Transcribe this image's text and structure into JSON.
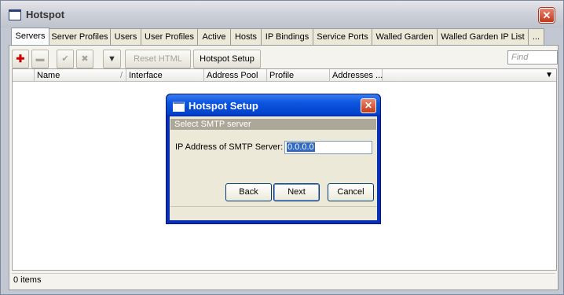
{
  "window": {
    "title": "Hotspot",
    "close_label": "✕"
  },
  "tabs": [
    {
      "label": "Servers"
    },
    {
      "label": "Server Profiles"
    },
    {
      "label": "Users"
    },
    {
      "label": "User Profiles"
    },
    {
      "label": "Active"
    },
    {
      "label": "Hosts"
    },
    {
      "label": "IP Bindings"
    },
    {
      "label": "Service Ports"
    },
    {
      "label": "Walled Garden"
    },
    {
      "label": "Walled Garden IP List"
    },
    {
      "label": "..."
    }
  ],
  "toolbar": {
    "add_glyph": "✚",
    "remove_glyph": "▬",
    "enable_glyph": "✔",
    "disable_glyph": "✖",
    "filter_glyph": "▼",
    "reset_html": "Reset HTML",
    "hotspot_setup": "Hotspot Setup",
    "find_placeholder": "Find"
  },
  "table": {
    "columns": [
      "Name",
      "Interface",
      "Address Pool",
      "Profile",
      "Addresses ..."
    ],
    "sort_glyph": "/",
    "menu_glyph": "▼"
  },
  "status": {
    "items": "0 items"
  },
  "dialog": {
    "title": "Hotspot Setup",
    "close_label": "✕",
    "subheading": "Select SMTP server",
    "field_label": "IP Address of SMTP Server:",
    "field_value": "0.0.0.0",
    "back": "Back",
    "next": "Next",
    "cancel": "Cancel"
  },
  "colors": {
    "accent": "#0d56e0",
    "add": "#cc0000",
    "close": "#c73a17"
  }
}
